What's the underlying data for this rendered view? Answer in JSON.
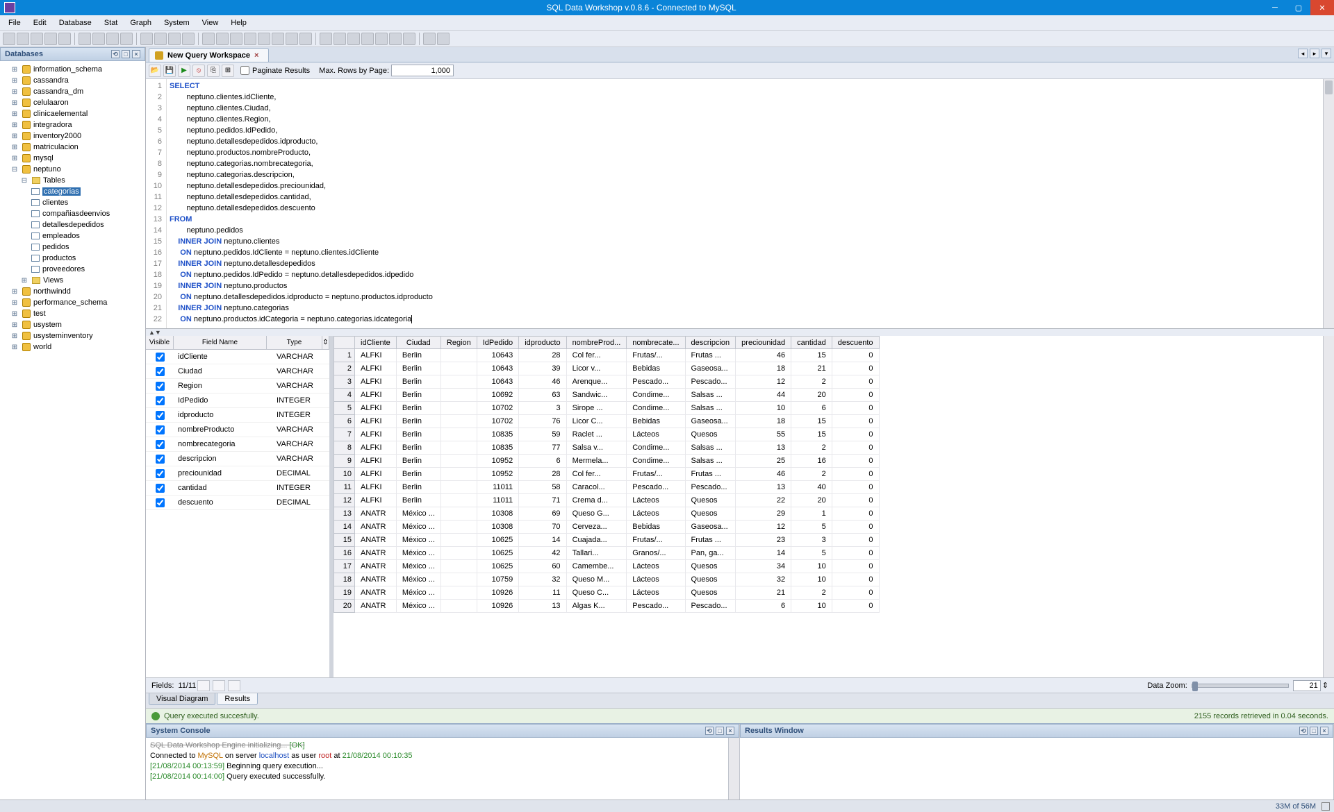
{
  "app": {
    "title": "SQL Data Workshop v.0.8.6 - Connected to MySQL"
  },
  "menu": [
    "File",
    "Edit",
    "Database",
    "Stat",
    "Graph",
    "System",
    "View",
    "Help"
  ],
  "sidebar": {
    "title": "Databases",
    "dbs": [
      "information_schema",
      "cassandra",
      "cassandra_dm",
      "celulaaron",
      "clinicaelemental",
      "integradora",
      "inventory2000",
      "matriculacion",
      "mysql"
    ],
    "open_db": "neptuno",
    "open_folder": "Tables",
    "selected_table": "categorias",
    "tables": [
      "clientes",
      "compañiasdeenvios",
      "detallesdepedidos",
      "empleados",
      "pedidos",
      "productos",
      "proveedores"
    ],
    "views_folder": "Views",
    "after_dbs": [
      "northwindd",
      "performance_schema",
      "test",
      "usystem",
      "usysteminventory",
      "world"
    ]
  },
  "tab": {
    "label": "New Query Workspace"
  },
  "querybar": {
    "paginate": "Paginate Results",
    "maxrows_label": "Max. Rows by Page:",
    "maxrows_value": "1,000"
  },
  "sql": {
    "lines": [
      {
        "n": 1,
        "kw": "SELECT",
        "rest": ""
      },
      {
        "n": 2,
        "kw": "",
        "rest": "        neptuno.clientes.idCliente,"
      },
      {
        "n": 3,
        "kw": "",
        "rest": "        neptuno.clientes.Ciudad,"
      },
      {
        "n": 4,
        "kw": "",
        "rest": "        neptuno.clientes.Region,"
      },
      {
        "n": 5,
        "kw": "",
        "rest": "        neptuno.pedidos.IdPedido,"
      },
      {
        "n": 6,
        "kw": "",
        "rest": "        neptuno.detallesdepedidos.idproducto,"
      },
      {
        "n": 7,
        "kw": "",
        "rest": "        neptuno.productos.nombreProducto,"
      },
      {
        "n": 8,
        "kw": "",
        "rest": "        neptuno.categorias.nombrecategoria,"
      },
      {
        "n": 9,
        "kw": "",
        "rest": "        neptuno.categorias.descripcion,"
      },
      {
        "n": 10,
        "kw": "",
        "rest": "        neptuno.detallesdepedidos.preciounidad,"
      },
      {
        "n": 11,
        "kw": "",
        "rest": "        neptuno.detallesdepedidos.cantidad,"
      },
      {
        "n": 12,
        "kw": "",
        "rest": "        neptuno.detallesdepedidos.descuento"
      },
      {
        "n": 13,
        "kw": "FROM",
        "rest": ""
      },
      {
        "n": 14,
        "kw": "",
        "rest": "        neptuno.pedidos"
      },
      {
        "n": 15,
        "kw": "    INNER JOIN",
        "rest": " neptuno.clientes"
      },
      {
        "n": 16,
        "kw": "     ON",
        "rest": " neptuno.pedidos.IdCliente = neptuno.clientes.idCliente"
      },
      {
        "n": 17,
        "kw": "    INNER JOIN",
        "rest": " neptuno.detallesdepedidos"
      },
      {
        "n": 18,
        "kw": "     ON",
        "rest": " neptuno.pedidos.IdPedido = neptuno.detallesdepedidos.idpedido"
      },
      {
        "n": 19,
        "kw": "    INNER JOIN",
        "rest": " neptuno.productos"
      },
      {
        "n": 20,
        "kw": "     ON",
        "rest": " neptuno.detallesdepedidos.idproducto = neptuno.productos.idproducto"
      },
      {
        "n": 21,
        "kw": "    INNER JOIN",
        "rest": " neptuno.categorias"
      },
      {
        "n": 22,
        "kw": "     ON",
        "rest": " neptuno.productos.idCategoria = neptuno.categorias.idcategoria"
      }
    ]
  },
  "fields": {
    "headers": {
      "vis": "Visible",
      "name": "Field Name",
      "type": "Type"
    },
    "rows": [
      {
        "name": "idCliente",
        "type": "VARCHAR"
      },
      {
        "name": "Ciudad",
        "type": "VARCHAR"
      },
      {
        "name": "Region",
        "type": "VARCHAR"
      },
      {
        "name": "IdPedido",
        "type": "INTEGER"
      },
      {
        "name": "idproducto",
        "type": "INTEGER"
      },
      {
        "name": "nombreProducto",
        "type": "VARCHAR"
      },
      {
        "name": "nombrecategoria",
        "type": "VARCHAR"
      },
      {
        "name": "descripcion",
        "type": "VARCHAR"
      },
      {
        "name": "preciounidad",
        "type": "DECIMAL"
      },
      {
        "name": "cantidad",
        "type": "INTEGER"
      },
      {
        "name": "descuento",
        "type": "DECIMAL"
      }
    ],
    "count_label": "Fields:",
    "count": "11/11"
  },
  "grid": {
    "columns": [
      "idCliente",
      "Ciudad",
      "Region",
      "IdPedido",
      "idproducto",
      "nombreProd...",
      "nombrecate...",
      "descripcion",
      "preciounidad",
      "cantidad",
      "descuento"
    ],
    "rows": [
      [
        "ALFKI",
        "Berlin",
        "",
        "10643",
        "28",
        "Col fer...",
        "Frutas/...",
        "Frutas ...",
        "46",
        "15",
        "0"
      ],
      [
        "ALFKI",
        "Berlin",
        "",
        "10643",
        "39",
        "Licor v...",
        "Bebidas",
        "Gaseosa...",
        "18",
        "21",
        "0"
      ],
      [
        "ALFKI",
        "Berlin",
        "",
        "10643",
        "46",
        "Arenque...",
        "Pescado...",
        "Pescado...",
        "12",
        "2",
        "0"
      ],
      [
        "ALFKI",
        "Berlin",
        "",
        "10692",
        "63",
        "Sandwic...",
        "Condime...",
        "Salsas ...",
        "44",
        "20",
        "0"
      ],
      [
        "ALFKI",
        "Berlin",
        "",
        "10702",
        "3",
        "Sirope ...",
        "Condime...",
        "Salsas ...",
        "10",
        "6",
        "0"
      ],
      [
        "ALFKI",
        "Berlin",
        "",
        "10702",
        "76",
        "Licor C...",
        "Bebidas",
        "Gaseosa...",
        "18",
        "15",
        "0"
      ],
      [
        "ALFKI",
        "Berlin",
        "",
        "10835",
        "59",
        "Raclet ...",
        "Lácteos",
        "Quesos",
        "55",
        "15",
        "0"
      ],
      [
        "ALFKI",
        "Berlin",
        "",
        "10835",
        "77",
        "Salsa v...",
        "Condime...",
        "Salsas ...",
        "13",
        "2",
        "0"
      ],
      [
        "ALFKI",
        "Berlin",
        "",
        "10952",
        "6",
        "Mermela...",
        "Condime...",
        "Salsas ...",
        "25",
        "16",
        "0"
      ],
      [
        "ALFKI",
        "Berlin",
        "",
        "10952",
        "28",
        "Col fer...",
        "Frutas/...",
        "Frutas ...",
        "46",
        "2",
        "0"
      ],
      [
        "ALFKI",
        "Berlin",
        "",
        "11011",
        "58",
        "Caracol...",
        "Pescado...",
        "Pescado...",
        "13",
        "40",
        "0"
      ],
      [
        "ALFKI",
        "Berlin",
        "",
        "11011",
        "71",
        "Crema d...",
        "Lácteos",
        "Quesos",
        "22",
        "20",
        "0"
      ],
      [
        "ANATR",
        "México ...",
        "",
        "10308",
        "69",
        "Queso G...",
        "Lácteos",
        "Quesos",
        "29",
        "1",
        "0"
      ],
      [
        "ANATR",
        "México ...",
        "",
        "10308",
        "70",
        "Cerveza...",
        "Bebidas",
        "Gaseosa...",
        "12",
        "5",
        "0"
      ],
      [
        "ANATR",
        "México ...",
        "",
        "10625",
        "14",
        "Cuajada...",
        "Frutas/...",
        "Frutas ...",
        "23",
        "3",
        "0"
      ],
      [
        "ANATR",
        "México ...",
        "",
        "10625",
        "42",
        "Tallari...",
        "Granos/...",
        "Pan, ga...",
        "14",
        "5",
        "0"
      ],
      [
        "ANATR",
        "México ...",
        "",
        "10625",
        "60",
        "Camembe...",
        "Lácteos",
        "Quesos",
        "34",
        "10",
        "0"
      ],
      [
        "ANATR",
        "México ...",
        "",
        "10759",
        "32",
        "Queso M...",
        "Lácteos",
        "Quesos",
        "32",
        "10",
        "0"
      ],
      [
        "ANATR",
        "México ...",
        "",
        "10926",
        "11",
        "Queso C...",
        "Lácteos",
        "Quesos",
        "21",
        "2",
        "0"
      ],
      [
        "ANATR",
        "México ...",
        "",
        "10926",
        "13",
        "Algas K...",
        "Pescado...",
        "Pescado...",
        "6",
        "10",
        "0"
      ]
    ]
  },
  "resfooter": {
    "zoom_label": "Data Zoom:",
    "zoom_value": "21"
  },
  "bottomtabs": {
    "vis": "Visual Diagram",
    "res": "Results"
  },
  "status": {
    "msg": "Query executed succesfully.",
    "right": "2155 records retrieved in 0.04 seconds."
  },
  "console": {
    "title": "System Console",
    "lines": [
      {
        "pre": "SQL Data Workshop Engine initializing... ",
        "ok": "[OK]"
      },
      {
        "t": "Connected to ",
        "a": "MySQL",
        "b": " on server ",
        "c": "localhost",
        "d": " as user ",
        "e": "root",
        "f": " at ",
        "g": "21/08/2014 00:10:35"
      },
      {
        "ts": "[21/08/2014 00:13:59] ",
        "msg": "Beginning query execution..."
      },
      {
        "ts": "[21/08/2014 00:14:00] ",
        "msg": "Query executed successfully."
      }
    ]
  },
  "output": {
    "title": "Results Window"
  },
  "statusbar": {
    "mem": "33M of 56M"
  }
}
